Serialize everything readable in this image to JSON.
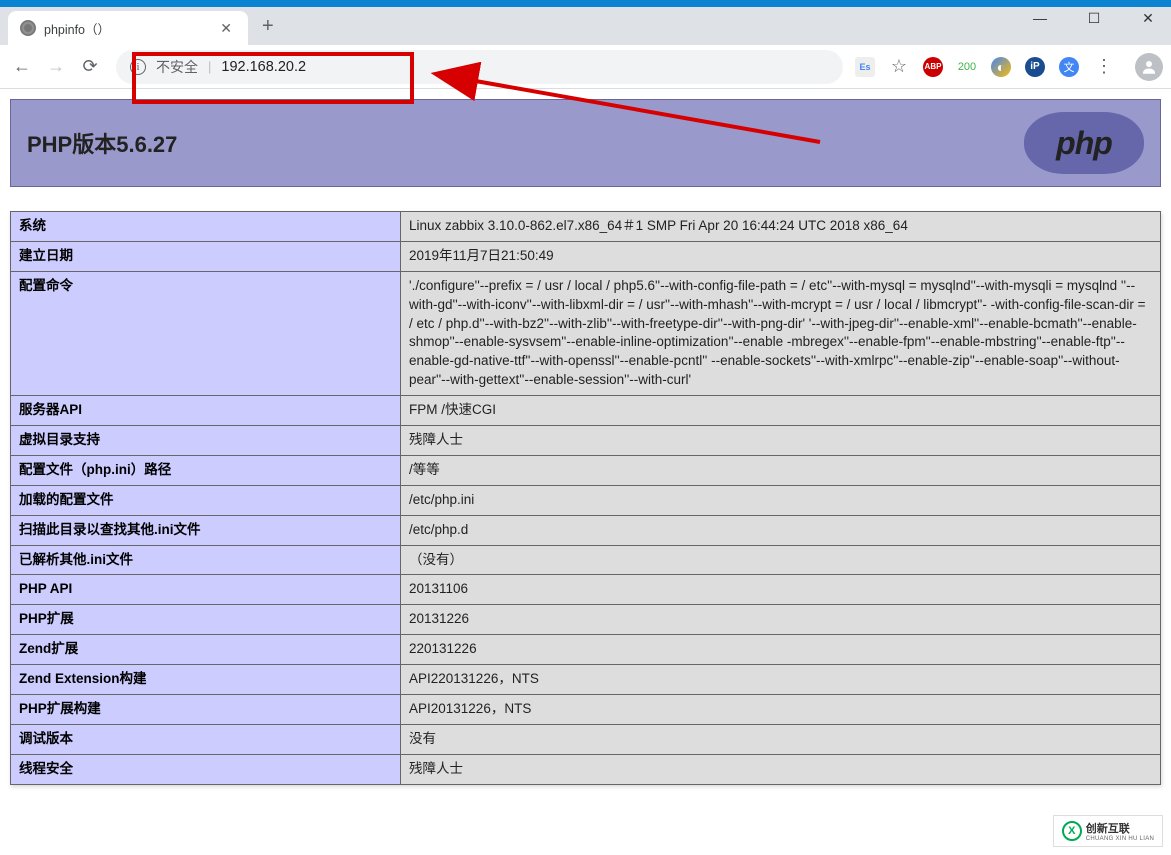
{
  "window": {
    "minimize": "—",
    "maximize": "☐",
    "close": "✕"
  },
  "tab": {
    "title": "phpinfo（）",
    "close": "✕",
    "newtab": "+"
  },
  "toolbar": {
    "back": "←",
    "forward": "→",
    "reload": "⟳"
  },
  "omnibox": {
    "info": "i",
    "security": "不安全",
    "separator": "|",
    "url": "192.168.20.2"
  },
  "ext_translate_es": "Es",
  "ext_star": "☆",
  "ext_abp": "ABP",
  "ext_count": "200",
  "ext_browser": "◐",
  "ext_ip": "iP",
  "page_title": "PHP版本5.6.27",
  "php_logo": "php",
  "rows": [
    {
      "k": "系统",
      "v": "Linux zabbix 3.10.0-862.el7.x86_64＃1 SMP Fri Apr 20 16:44:24 UTC 2018 x86_64"
    },
    {
      "k": "建立日期",
      "v": "2019年11月7日21:50:49"
    },
    {
      "k": "配置命令",
      "v": "'./configure''--prefix = / usr / local / php5.6''--with-config-file-path = / etc''--with-mysql = mysqlnd''--with-mysqli = mysqlnd ''--with-gd''--with-iconv''--with-libxml-dir = / usr''--with-mhash''--with-mcrypt = / usr / local / libmcrypt''- -with-config-file-scan-dir = / etc / php.d''--with-bz2''--with-zlib''--with-freetype-dir''--with-png-dir' '--with-jpeg-dir''--enable-xml''--enable-bcmath''--enable-shmop''--enable-sysvsem''--enable-inline-optimization''--enable -mbregex''--enable-fpm''--enable-mbstring''--enable-ftp''--enable-gd-native-ttf''--with-openssl''--enable-pcntl'' --enable-sockets''--with-xmlrpc''--enable-zip''--enable-soap''--without-pear''--with-gettext''--enable-session''--with-curl'"
    },
    {
      "k": "服务器API",
      "v": "FPM /快速CGI"
    },
    {
      "k": "虚拟目录支持",
      "v": "残障人士"
    },
    {
      "k": "配置文件（php.ini）路径",
      "v": "/等等"
    },
    {
      "k": "加载的配置文件",
      "v": "/etc/php.ini"
    },
    {
      "k": "扫描此目录以查找其他.ini文件",
      "v": "/etc/php.d"
    },
    {
      "k": "已解析其他.ini文件",
      "v": "（没有）"
    },
    {
      "k": "PHP API",
      "v": "20131106"
    },
    {
      "k": "PHP扩展",
      "v": "20131226"
    },
    {
      "k": "Zend扩展",
      "v": "220131226"
    },
    {
      "k": "Zend Extension构建",
      "v": "API220131226，NTS"
    },
    {
      "k": "PHP扩展构建",
      "v": "API20131226，NTS"
    },
    {
      "k": "调试版本",
      "v": "没有"
    },
    {
      "k": "线程安全",
      "v": "残障人士"
    }
  ],
  "watermark": {
    "logo": "X",
    "text1": "创新互联",
    "text2": "CHUANG XIN HU LIAN"
  }
}
